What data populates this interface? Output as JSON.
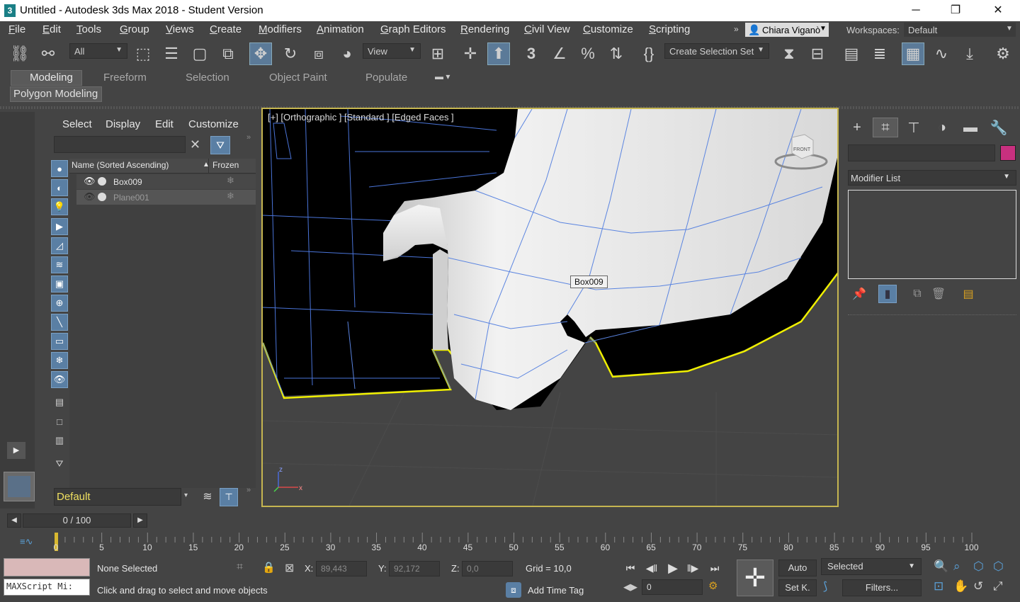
{
  "window": {
    "app_icon": "3",
    "title": "Untitled - Autodesk 3ds Max 2018 - Student Version",
    "minimize_glyph": "─",
    "maximize_glyph": "❐",
    "close_glyph": "✕"
  },
  "menu": [
    "File",
    "Edit",
    "Tools",
    "Group",
    "Views",
    "Create",
    "Modifiers",
    "Animation",
    "Graph Editors",
    "Rendering",
    "Civil View",
    "Customize",
    "Scripting"
  ],
  "user": {
    "name": "Chiara Viganò"
  },
  "workspaces": {
    "label": "Workspaces:",
    "value": "Default"
  },
  "toolbar": {
    "selection_filter": "All",
    "reference_coord": "View",
    "snap_label": "3",
    "selection_set": "Create Selection Set"
  },
  "ribbon": {
    "tabs": [
      "Modeling",
      "Freeform",
      "Selection",
      "Object Paint",
      "Populate"
    ],
    "active_tab": "Modeling",
    "panel": "Polygon Modeling"
  },
  "explorer": {
    "tabs": [
      "Select",
      "Display",
      "Edit",
      "Customize"
    ],
    "columns": [
      "Name (Sorted Ascending)",
      "Frozen"
    ],
    "sort_glyph": "▲",
    "rows": [
      {
        "name": "Box009",
        "visible": true
      },
      {
        "name": "Plane001",
        "visible": false
      }
    ],
    "layer": "Default"
  },
  "viewport": {
    "label": "[+] [Orthographic ] [Standard ] [Edged Faces ]",
    "tooltip": "Box009",
    "viewcube_face": "FRONT",
    "axis_z": "z",
    "axis_x": "x"
  },
  "command_panel": {
    "modifier_list": "Modifier List",
    "swatch_color": "#c8307f"
  },
  "time": {
    "slider": "0 / 100",
    "ticks": [
      "0",
      "5",
      "10",
      "15",
      "20",
      "25",
      "30",
      "35",
      "40",
      "45",
      "50",
      "55",
      "60",
      "65",
      "70",
      "75",
      "80",
      "85",
      "90",
      "95",
      "100"
    ]
  },
  "status": {
    "selection": "None Selected",
    "prompt": "Click and drag to select and move objects",
    "maxscript": "MAXScript Mi:",
    "x_label": "X:",
    "x": "89,443",
    "y_label": "Y:",
    "y": "92,172",
    "z_label": "Z:",
    "z": "0,0",
    "grid": "Grid = 10,0",
    "add_time_tag": "Add Time Tag",
    "auto": "Auto",
    "set_key": "Set K.",
    "selected": "Selected",
    "filters": "Filters...",
    "frame": "0"
  },
  "colors": {
    "accent": "#5a7fa4",
    "viewport_border": "#c5b550",
    "selection_outline": "#f0f000"
  }
}
